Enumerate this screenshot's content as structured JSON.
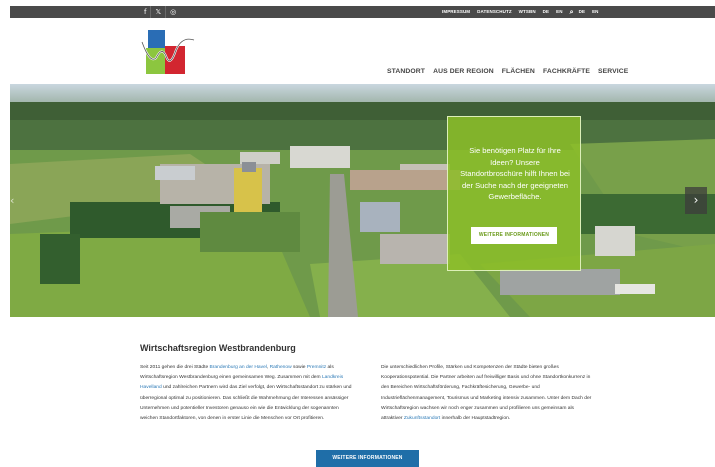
{
  "social": {
    "facebook": "f",
    "x": "𝕏",
    "instagram": "◎"
  },
  "topnav": {
    "items": [
      "IMPRESSUM",
      "DATENSCHUTZ",
      "WTSBN",
      "DE",
      "EN"
    ],
    "search_icon": "⌕",
    "lang2": [
      "DE",
      "EN"
    ]
  },
  "logo": {
    "colors": [
      "#2a6db5",
      "#8cc63f",
      "#d22630"
    ]
  },
  "mainnav": [
    "STANDORT",
    "AUS DER REGION",
    "FLÄCHEN",
    "FACHKRÄFTE",
    "SERVICE"
  ],
  "hero": {
    "callout_text": "Sie benötigen Platz für Ihre Ideen? Unsere Standortbroschüre hilft Ihnen bei der Suche nach der geeigneten Gewerbefläche.",
    "callout_button": "WEITERE INFORMATIONEN",
    "next": "›",
    "prev": "‹"
  },
  "content": {
    "title": "Wirtschaftsregion Westbrandenburg",
    "col1": {
      "p1": "Seit 2011 gehen die drei Städte ",
      "l1": "Brandenburg an der Havel",
      "p2": ", ",
      "l2": "Rathenow",
      "p3": " sowie ",
      "l3": "Premnitz",
      "p4": " als Wirtschaftsregion Westbrandenburg einen gemeinsamen Weg. Zusammen mit dem ",
      "l4": "Landkreis Havelland",
      "p5": " und zahlreichen Partnern wird das Ziel verfolgt, den Wirtschaftsstandort zu stärken und überregional optimal zu positionieren. Das schließt die Wahrnehmung der Interessen ansässiger Unternehmen und potentieller Investoren genauso ein wie die Entwicklung der sogenannten weichen Standortfaktoren, von denen in erster Linie die Menschen vor Ort profitieren."
    },
    "col2": {
      "p1": "Die unterschiedlichen Profile, Stärken und Kompetenzen der Städte bieten großes Kooperationspotential. Die Partner arbeiten auf freiwilliger Basis und ohne Standortkonkurrenz in den Bereichen Wirtschaftsförderung, Fachkräftesicherung, Gewerbe- und Industrieflächenmanagement, Tourismus und Marketing intensiv zusammen. Unter dem Dach der Wirtschaftsregion wachsen wir noch enger zusammen und profilieren uns gemeinsam als attraktiver ",
      "l1": "Zukunftsstandort",
      "p2": " innerhalb der Hauptstadtregion."
    },
    "button": "WEITERE INFORMATIONEN"
  }
}
